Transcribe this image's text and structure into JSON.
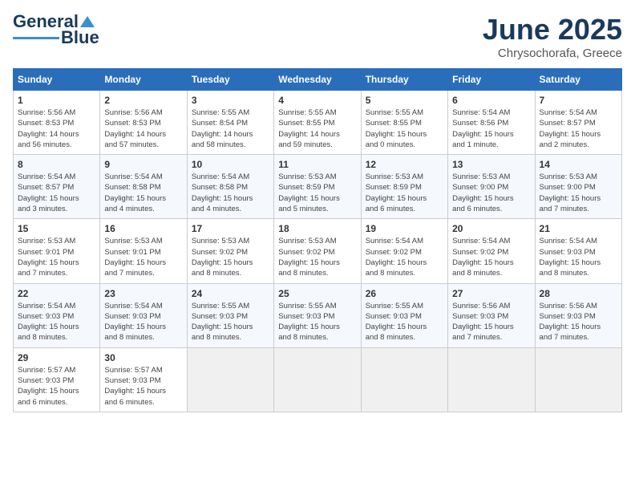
{
  "logo": {
    "line1": "General",
    "line2": "Blue"
  },
  "title": "June 2025",
  "location": "Chrysochorafa, Greece",
  "weekdays": [
    "Sunday",
    "Monday",
    "Tuesday",
    "Wednesday",
    "Thursday",
    "Friday",
    "Saturday"
  ],
  "weeks": [
    [
      {
        "day": "1",
        "info": "Sunrise: 5:56 AM\nSunset: 8:53 PM\nDaylight: 14 hours\nand 56 minutes."
      },
      {
        "day": "2",
        "info": "Sunrise: 5:56 AM\nSunset: 8:53 PM\nDaylight: 14 hours\nand 57 minutes."
      },
      {
        "day": "3",
        "info": "Sunrise: 5:55 AM\nSunset: 8:54 PM\nDaylight: 14 hours\nand 58 minutes."
      },
      {
        "day": "4",
        "info": "Sunrise: 5:55 AM\nSunset: 8:55 PM\nDaylight: 14 hours\nand 59 minutes."
      },
      {
        "day": "5",
        "info": "Sunrise: 5:55 AM\nSunset: 8:55 PM\nDaylight: 15 hours\nand 0 minutes."
      },
      {
        "day": "6",
        "info": "Sunrise: 5:54 AM\nSunset: 8:56 PM\nDaylight: 15 hours\nand 1 minute."
      },
      {
        "day": "7",
        "info": "Sunrise: 5:54 AM\nSunset: 8:57 PM\nDaylight: 15 hours\nand 2 minutes."
      }
    ],
    [
      {
        "day": "8",
        "info": "Sunrise: 5:54 AM\nSunset: 8:57 PM\nDaylight: 15 hours\nand 3 minutes."
      },
      {
        "day": "9",
        "info": "Sunrise: 5:54 AM\nSunset: 8:58 PM\nDaylight: 15 hours\nand 4 minutes."
      },
      {
        "day": "10",
        "info": "Sunrise: 5:54 AM\nSunset: 8:58 PM\nDaylight: 15 hours\nand 4 minutes."
      },
      {
        "day": "11",
        "info": "Sunrise: 5:53 AM\nSunset: 8:59 PM\nDaylight: 15 hours\nand 5 minutes."
      },
      {
        "day": "12",
        "info": "Sunrise: 5:53 AM\nSunset: 8:59 PM\nDaylight: 15 hours\nand 6 minutes."
      },
      {
        "day": "13",
        "info": "Sunrise: 5:53 AM\nSunset: 9:00 PM\nDaylight: 15 hours\nand 6 minutes."
      },
      {
        "day": "14",
        "info": "Sunrise: 5:53 AM\nSunset: 9:00 PM\nDaylight: 15 hours\nand 7 minutes."
      }
    ],
    [
      {
        "day": "15",
        "info": "Sunrise: 5:53 AM\nSunset: 9:01 PM\nDaylight: 15 hours\nand 7 minutes."
      },
      {
        "day": "16",
        "info": "Sunrise: 5:53 AM\nSunset: 9:01 PM\nDaylight: 15 hours\nand 7 minutes."
      },
      {
        "day": "17",
        "info": "Sunrise: 5:53 AM\nSunset: 9:02 PM\nDaylight: 15 hours\nand 8 minutes."
      },
      {
        "day": "18",
        "info": "Sunrise: 5:53 AM\nSunset: 9:02 PM\nDaylight: 15 hours\nand 8 minutes."
      },
      {
        "day": "19",
        "info": "Sunrise: 5:54 AM\nSunset: 9:02 PM\nDaylight: 15 hours\nand 8 minutes."
      },
      {
        "day": "20",
        "info": "Sunrise: 5:54 AM\nSunset: 9:02 PM\nDaylight: 15 hours\nand 8 minutes."
      },
      {
        "day": "21",
        "info": "Sunrise: 5:54 AM\nSunset: 9:03 PM\nDaylight: 15 hours\nand 8 minutes."
      }
    ],
    [
      {
        "day": "22",
        "info": "Sunrise: 5:54 AM\nSunset: 9:03 PM\nDaylight: 15 hours\nand 8 minutes."
      },
      {
        "day": "23",
        "info": "Sunrise: 5:54 AM\nSunset: 9:03 PM\nDaylight: 15 hours\nand 8 minutes."
      },
      {
        "day": "24",
        "info": "Sunrise: 5:55 AM\nSunset: 9:03 PM\nDaylight: 15 hours\nand 8 minutes."
      },
      {
        "day": "25",
        "info": "Sunrise: 5:55 AM\nSunset: 9:03 PM\nDaylight: 15 hours\nand 8 minutes."
      },
      {
        "day": "26",
        "info": "Sunrise: 5:55 AM\nSunset: 9:03 PM\nDaylight: 15 hours\nand 8 minutes."
      },
      {
        "day": "27",
        "info": "Sunrise: 5:56 AM\nSunset: 9:03 PM\nDaylight: 15 hours\nand 7 minutes."
      },
      {
        "day": "28",
        "info": "Sunrise: 5:56 AM\nSunset: 9:03 PM\nDaylight: 15 hours\nand 7 minutes."
      }
    ],
    [
      {
        "day": "29",
        "info": "Sunrise: 5:57 AM\nSunset: 9:03 PM\nDaylight: 15 hours\nand 6 minutes."
      },
      {
        "day": "30",
        "info": "Sunrise: 5:57 AM\nSunset: 9:03 PM\nDaylight: 15 hours\nand 6 minutes."
      },
      null,
      null,
      null,
      null,
      null
    ]
  ]
}
